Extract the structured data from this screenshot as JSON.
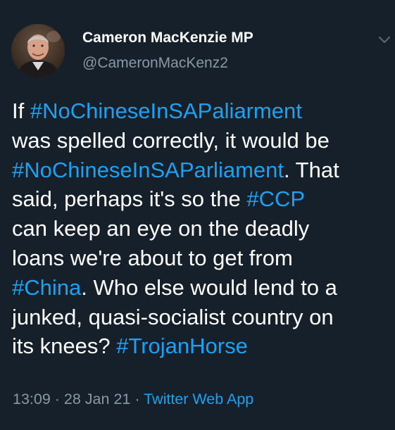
{
  "author": {
    "name": "Cameron MacKenzie MP",
    "handle": "@CameronMacKenz2",
    "avatar_icon": "profile-photo"
  },
  "menu": {
    "icon": "chevron-down-icon"
  },
  "tweet": {
    "lines": [
      [
        {
          "text": "If ",
          "type": "text"
        },
        {
          "text": "#NoChineseInSAPaliarment",
          "type": "hashtag"
        }
      ],
      [
        {
          "text": "was spelled correctly, it would be",
          "type": "text"
        }
      ],
      [
        {
          "text": "#NoChineseInSAParliament",
          "type": "hashtag"
        },
        {
          "text": ". That",
          "type": "text"
        }
      ],
      [
        {
          "text": "said, perhaps it's so the ",
          "type": "text"
        },
        {
          "text": "#CCP",
          "type": "hashtag"
        }
      ],
      [
        {
          "text": "can keep an eye on the deadly",
          "type": "text"
        }
      ],
      [
        {
          "text": "loans we're about to get from",
          "type": "text"
        }
      ],
      [
        {
          "text": "#China",
          "type": "hashtag"
        },
        {
          "text": ". Who else would lend to a",
          "type": "text"
        }
      ],
      [
        {
          "text": "junked, quasi-socialist country on",
          "type": "text"
        }
      ],
      [
        {
          "text": "its knees? ",
          "type": "text"
        },
        {
          "text": "#TrojanHorse",
          "type": "hashtag"
        }
      ]
    ]
  },
  "meta": {
    "time": "13:09",
    "separator": " · ",
    "date": "28 Jan 21",
    "source": "Twitter Web App"
  },
  "colors": {
    "background": "#15202b",
    "text": "#ffffff",
    "secondary": "#8899a6",
    "accent": "#1da1f2"
  }
}
